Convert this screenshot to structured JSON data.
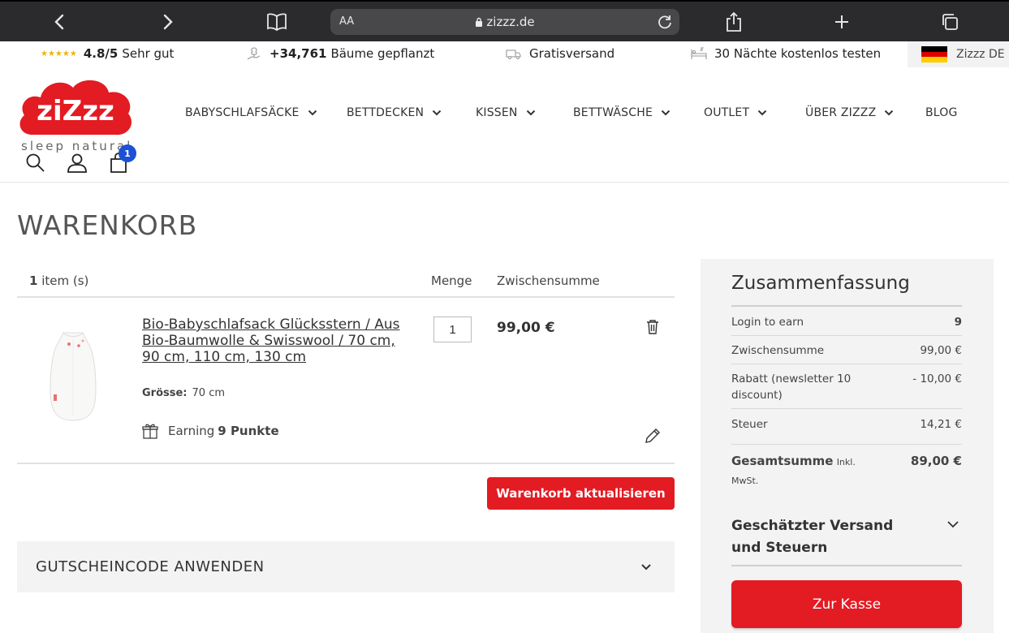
{
  "browser": {
    "url_aa": "AA",
    "url": "zizzz.de"
  },
  "usp": {
    "rating_stars": "★★★★★",
    "rating_value": "4.8/5",
    "rating_text": "Sehr gut",
    "trees_count": "+34,761",
    "trees_text": "Bäume gepflanzt",
    "shipping": "Gratisversand",
    "trial": "30 Nächte kostenlos testen",
    "language": "Zizzz DE"
  },
  "header": {
    "logo_text": "ziZzz",
    "tagline": "sleep natural",
    "cart_count": "1",
    "nav": [
      {
        "label": "BABYSCHLAFSÄCKE"
      },
      {
        "label": "BETTDECKEN"
      },
      {
        "label": "KISSEN"
      },
      {
        "label": "BETTWÄSCHE"
      },
      {
        "label": "OUTLET"
      },
      {
        "label": "ÜBER ZIZZZ"
      },
      {
        "label": "BLOG"
      }
    ]
  },
  "cart": {
    "title": "WARENKORB",
    "item_count": "1",
    "item_count_suffix": "item (s)",
    "col_qty": "Menge",
    "col_subtotal": "Zwischensumme",
    "product": {
      "name": "Bio-Babyschlafsack Glücksstern / Aus Bio-Baumwolle & Swisswool / 70 cm, 90 cm, 110 cm, 130 cm",
      "size_label": "Grösse:",
      "size_value": "70 cm",
      "earning_prefix": "Earning",
      "earning_points": "9 Punkte",
      "qty": "1",
      "price": "99,00 €"
    },
    "update_button": "Warenkorb aktualisieren",
    "coupon_label": "GUTSCHEINCODE ANWENDEN"
  },
  "summary": {
    "title": "Zusammenfassung",
    "rows": [
      {
        "label": "Login to earn",
        "value": "9"
      },
      {
        "label": "Zwischensumme",
        "value": "99,00 €"
      },
      {
        "label": "Rabatt (newsletter 10 discount)",
        "value": "- 10,00 €"
      },
      {
        "label": "Steuer",
        "value": "14,21 €"
      }
    ],
    "total_label": "Gesamtsumme",
    "total_note": "Inkl. MwSt.",
    "total_value": "89,00 €",
    "shipping_label": "Geschätzter Versand und Steuern",
    "checkout_button": "Zur Kasse"
  },
  "colors": {
    "brand_red": "#e31b23",
    "badge_blue": "#1e50d6",
    "star_gold": "#f2b300"
  }
}
